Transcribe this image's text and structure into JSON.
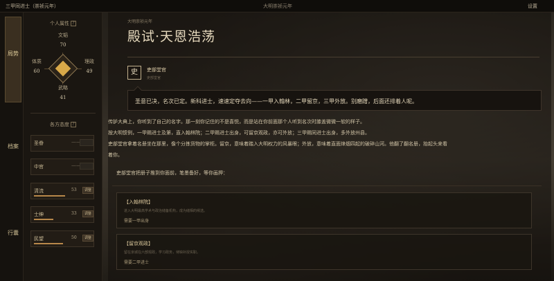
{
  "topbar": {
    "left": "三甲同进士（崇祯元年）",
    "center": "大明崇祯元年",
    "right": "设置"
  },
  "rail": {
    "items": [
      {
        "label": "局势",
        "active": true
      },
      {
        "label": "档案"
      },
      {
        "label": "行囊"
      }
    ]
  },
  "stats": {
    "title": "个人属性",
    "help": "?",
    "wen": {
      "label": "文韬",
      "value": "70"
    },
    "tizhi": {
      "label": "体质",
      "value": "60"
    },
    "lizheng": {
      "label": "理政",
      "value": "49"
    },
    "wulue": {
      "label": "武略",
      "value": "41"
    }
  },
  "factions": {
    "title": "各方态度",
    "help": "?",
    "items": [
      {
        "name": "圣眷",
        "value": "——",
        "button": ""
      },
      {
        "name": "中官",
        "value": "——",
        "button": ""
      },
      {
        "name": "清流",
        "value": "53",
        "button": "调整",
        "fill": 0.53
      },
      {
        "name": "士绅",
        "value": "33",
        "button": "调整",
        "fill": 0.33
      },
      {
        "name": "民望",
        "value": "50",
        "button": "调整",
        "fill": 0.5
      }
    ]
  },
  "scene": {
    "crumb": "大明崇祯元年",
    "title": "殿试·天恩浩荡",
    "speaker_char": "史",
    "speaker_name": "吏部堂官",
    "speaker_sub": "吏部堂官",
    "quote": "圣意已决，名次已定。新科进士，速速定夺去向——一甲入翰林，二甲留京，三甲外放。别磨蹭，后面还排着人呢。",
    "narr1": "传胪大典上，你听到了自己的名字。那一刻你记住的不是喜悦，而是站在你前面那个人听到名次时膝盖微微一软的样子。",
    "narr2": "按大明惯例，一甲赐进士及第，直入翰林院；二甲赐进士出身，可留京观政，亦可外放；三甲赐同进士出身，多外放州县。",
    "narr3": "吏部堂官拿着名册坐在那里，像个分拣货物的掌柜。留京，意味着踏入大明权力的风暴眼；外放，意味着直面烽烟四起的破碎山河。他翻了翻名册，抬起头来看",
    "narr4": "着你。",
    "prompt": "吏部堂官把册子推到你面前，笔墨备好，等你画押：",
    "choices": [
      {
        "title": "【入翰林院】",
        "desc": "进入大明最高学术与政治储备机构，成为储相的候选。",
        "req": "需要一甲出身"
      },
      {
        "title": "【留京观政】",
        "desc": "留在京城在六部观政，学习政务，待缺补授实职。",
        "req": "需要二甲进士"
      }
    ]
  }
}
